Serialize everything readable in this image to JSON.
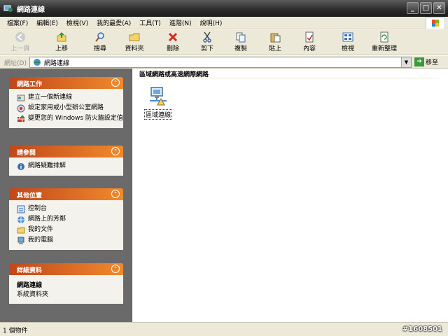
{
  "window": {
    "title": "網路連線"
  },
  "menu": [
    "檔案(F)",
    "編輯(E)",
    "檢視(V)",
    "我的最愛(A)",
    "工具(T)",
    "進階(N)",
    "說明(H)"
  ],
  "toolbar": {
    "back": "上一頁",
    "up": "上移",
    "search": "搜尋",
    "folders": "資料夾",
    "delete": "刪除",
    "cut": "剪下",
    "copy": "複製",
    "paste": "貼上",
    "properties": "內容",
    "views": "檢視",
    "arrange": "重新整理"
  },
  "address": {
    "label": "網址(D)",
    "value": "網路連線",
    "go": "移至"
  },
  "sidebar": {
    "network_tasks": {
      "title": "網路工作",
      "items": [
        "建立一個新連線",
        "設定家用或小型辦公室網路",
        "變更您的 Windows 防火牆設定值"
      ]
    },
    "see_also": {
      "title": "請參閱",
      "items": [
        "網路疑難排解"
      ]
    },
    "other_places": {
      "title": "其他位置",
      "items": [
        "控制台",
        "網路上的芳鄰",
        "我的文件",
        "我的電腦"
      ]
    },
    "details": {
      "title": "詳細資料",
      "name": "網路連線",
      "type": "系統資料夾"
    }
  },
  "main": {
    "section_title": "區域網路或高速網際網路",
    "items": [
      {
        "label": "區域連線"
      }
    ]
  },
  "status": {
    "text": "1 個物件"
  },
  "watermark": "#1608501"
}
